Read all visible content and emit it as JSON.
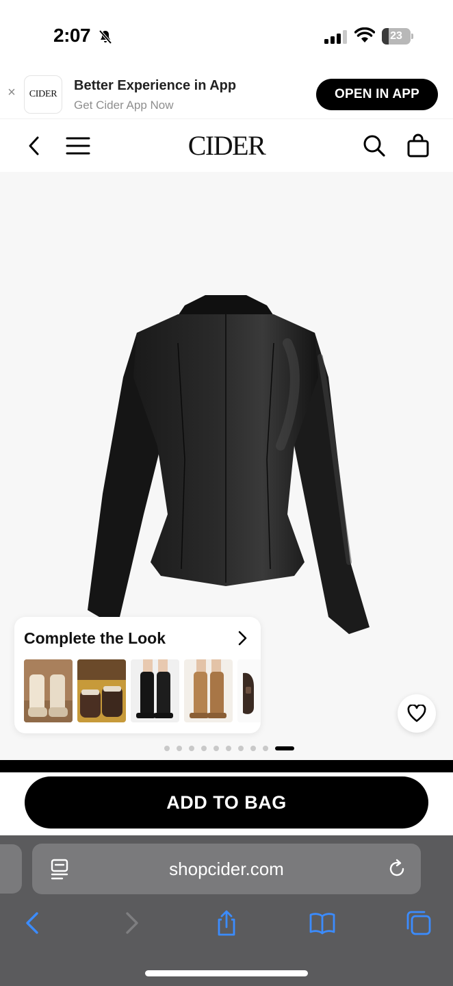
{
  "status_bar": {
    "time": "2:07",
    "battery": "23",
    "battery_level": 0.23
  },
  "app_banner": {
    "close_glyph": "×",
    "logo_text": "CIDER",
    "title": "Better Experience in App",
    "subtitle": "Get Cider App Now",
    "button": "OPEN IN APP"
  },
  "header": {
    "logo": "CIDER",
    "icons": [
      "back-icon",
      "menu-icon",
      "search-icon",
      "bag-icon"
    ]
  },
  "product": {
    "complete_look": {
      "title": "Complete the Look",
      "thumbnails": [
        "cream-snow-boots",
        "brown-fur-boots",
        "black-knee-boots",
        "tan-knee-boots",
        "brown-loafer"
      ]
    },
    "gallery": {
      "total_images": 10,
      "active_index": 9
    }
  },
  "cta": {
    "add_to_bag": "ADD TO BAG"
  },
  "browser": {
    "url": "shopcider.com",
    "toolbar": [
      "back-icon",
      "forward-icon",
      "share-icon",
      "bookmarks-icon",
      "tabs-icon"
    ]
  },
  "colors": {
    "accent_blue": "#3b8cff",
    "brand_black": "#000000"
  }
}
